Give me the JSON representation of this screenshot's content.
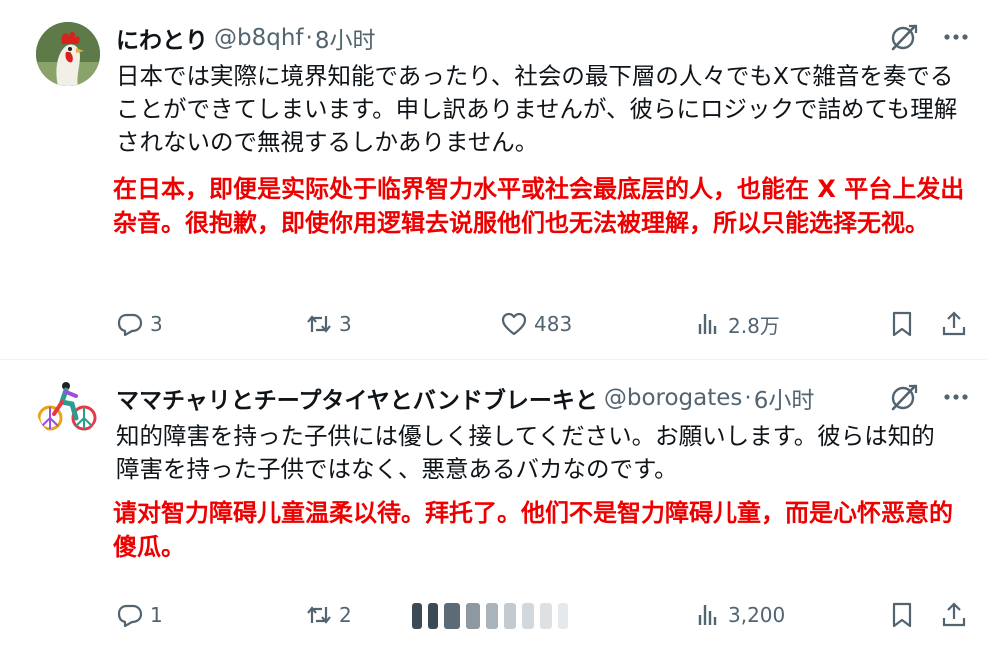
{
  "tweets": [
    {
      "name": "にわとり",
      "handle": "@b8qhf",
      "dot": "·",
      "time": "8小时",
      "text_jp": "日本では実際に境界知能であったり、社会の最下層の人々でもXで雑音を奏でることができてしまいます。申し訳ありませんが、彼らにロジックで詰めても理解されないので無視するしかありません。",
      "text_zh": "在日本，即便是实际处于临界智力水平或社会最底层的人，也能在 X 平台上发出杂音。很抱歉，即使你用逻辑去说服他们也无法被理解，所以只能选择无视。",
      "replies": "3",
      "retweets": "3",
      "likes": "483",
      "views": "2.8万",
      "avatar_icon": "rooster-avatar"
    },
    {
      "name": "ママチャリとチープタイヤとバンドブレーキと",
      "handle": "@borogates",
      "dot": "·",
      "time": "6小时",
      "text_jp": "知的障害を持った子供には優しく接してください。お願いします。彼らは知的障害を持った子供ではなく、悪意あるバカなのです。",
      "text_zh": "请对智力障碍儿童温柔以待。拜托了。他们不是智力障碍儿童，而是心怀恶意的傻瓜。",
      "replies": "1",
      "retweets": "2",
      "views": "3,200",
      "avatar_icon": "cyclist-peace-avatar"
    }
  ],
  "colors": {
    "translation_red": "#ee0000",
    "muted_gray": "#536471",
    "text_black": "#0f1419"
  },
  "icons": [
    "grok-icon",
    "more-icon",
    "reply-icon",
    "retweet-icon",
    "like-icon",
    "views-icon",
    "bookmark-icon",
    "share-icon"
  ]
}
